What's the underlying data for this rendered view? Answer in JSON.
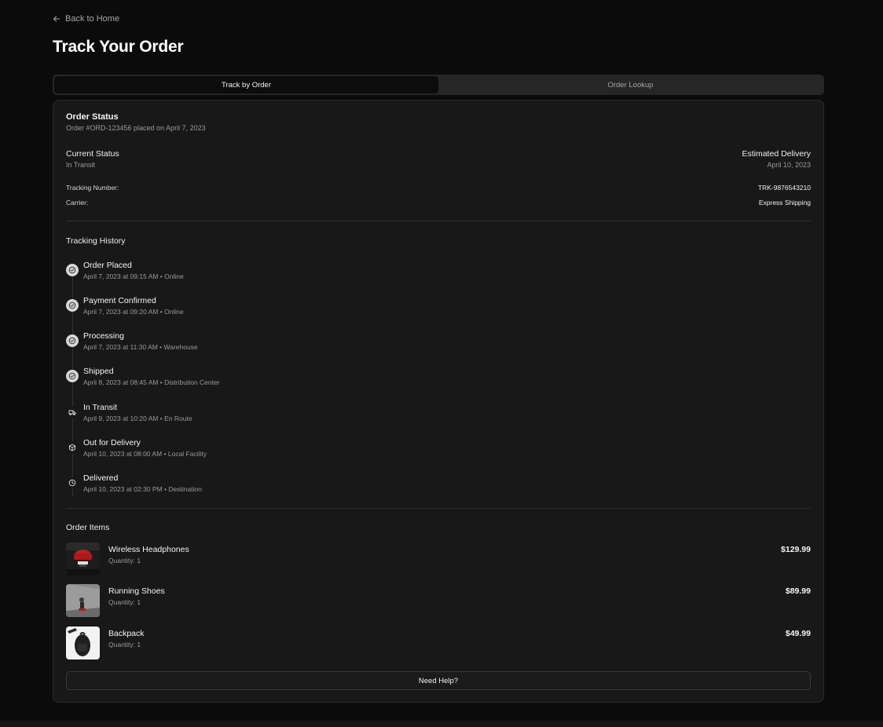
{
  "nav": {
    "back_label": "Back to Home"
  },
  "page": {
    "title": "Track Your Order"
  },
  "tabs": [
    {
      "label": "Track by Order",
      "active": true
    },
    {
      "label": "Order Lookup",
      "active": false
    }
  ],
  "order": {
    "status_heading": "Order Status",
    "summary": "Order #ORD-123456 placed on April 7, 2023",
    "current_status_label": "Current Status",
    "current_status_value": "In Transit",
    "estimated_delivery_label": "Estimated Delivery",
    "estimated_delivery_value": "April 10, 2023",
    "tracking_number_label": "Tracking Number:",
    "tracking_number_value": "TRK-9876543210",
    "carrier_label": "Carrier:",
    "carrier_value": "Express Shipping"
  },
  "history": {
    "heading": "Tracking History",
    "events": [
      {
        "title": "Order Placed",
        "meta": "April 7, 2023 at 09:15 AM • Online",
        "icon": "check-circle-icon",
        "done": true
      },
      {
        "title": "Payment Confirmed",
        "meta": "April 7, 2023 at 09:20 AM • Online",
        "icon": "check-circle-icon",
        "done": true
      },
      {
        "title": "Processing",
        "meta": "April 7, 2023 at 11:30 AM • Warehouse",
        "icon": "check-circle-icon",
        "done": true
      },
      {
        "title": "Shipped",
        "meta": "April 8, 2023 at 08:45 AM • Distribution Center",
        "icon": "check-circle-icon",
        "done": true
      },
      {
        "title": "In Transit",
        "meta": "April 9, 2023 at 10:20 AM • En Route",
        "icon": "truck-icon",
        "done": false
      },
      {
        "title": "Out for Delivery",
        "meta": "April 10, 2023 at 08:00 AM • Local Facility",
        "icon": "package-icon",
        "done": false
      },
      {
        "title": "Delivered",
        "meta": "April 10, 2023 at 02:30 PM • Destination",
        "icon": "clock-icon",
        "done": false
      }
    ]
  },
  "items": {
    "heading": "Order Items",
    "list": [
      {
        "name": "Wireless Headphones",
        "quantity": "Quantity: 1",
        "price": "$129.99"
      },
      {
        "name": "Running Shoes",
        "quantity": "Quantity: 1",
        "price": "$89.99"
      },
      {
        "name": "Backpack",
        "quantity": "Quantity: 1",
        "price": "$49.99"
      }
    ]
  },
  "help": {
    "label": "Need Help?"
  }
}
